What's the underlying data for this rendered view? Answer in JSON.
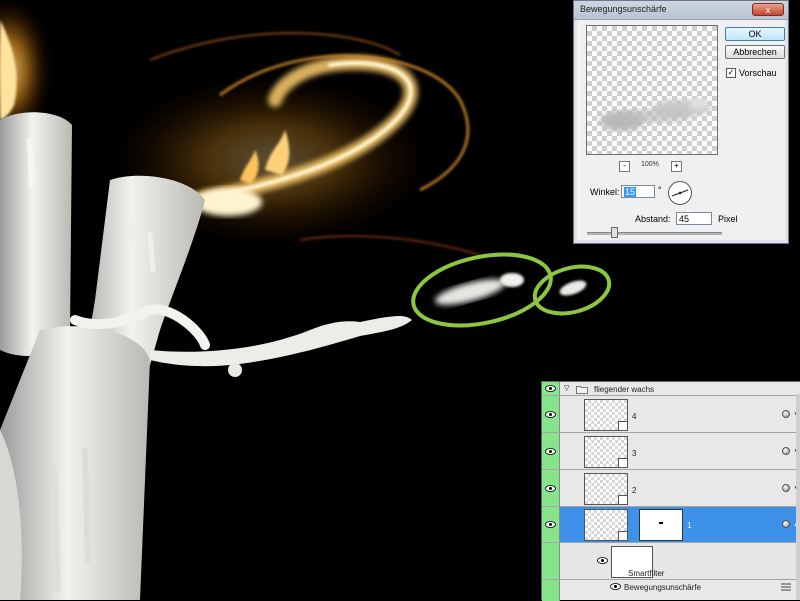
{
  "dialog": {
    "title": "Bewegungsunschärfe",
    "close_label": "x",
    "ok_label": "OK",
    "cancel_label": "Abbrechen",
    "preview_label": "Vorschau",
    "preview_checked_mark": "✓",
    "zoom_out": "-",
    "zoom_in": "+",
    "zoom_value": "100%",
    "angle_label": "Winkel:",
    "angle_value": "15",
    "angle_unit": "°",
    "distance_label": "Abstand:",
    "distance_value": "45",
    "distance_unit": "Pixel",
    "slider_fraction": 0.2
  },
  "layers": {
    "group_name": "fliegender wachs",
    "rows": [
      {
        "name": "4"
      },
      {
        "name": "3"
      },
      {
        "name": "2"
      },
      {
        "name": "1",
        "selected": true
      }
    ],
    "smartfilter_label": "Smartfilter",
    "filter_name": "Bewegungsunschärfe"
  },
  "colors": {
    "highlight_ring": "#8dc63f",
    "layer_selected": "#3d91e8",
    "eye_column": "#86e58b"
  }
}
